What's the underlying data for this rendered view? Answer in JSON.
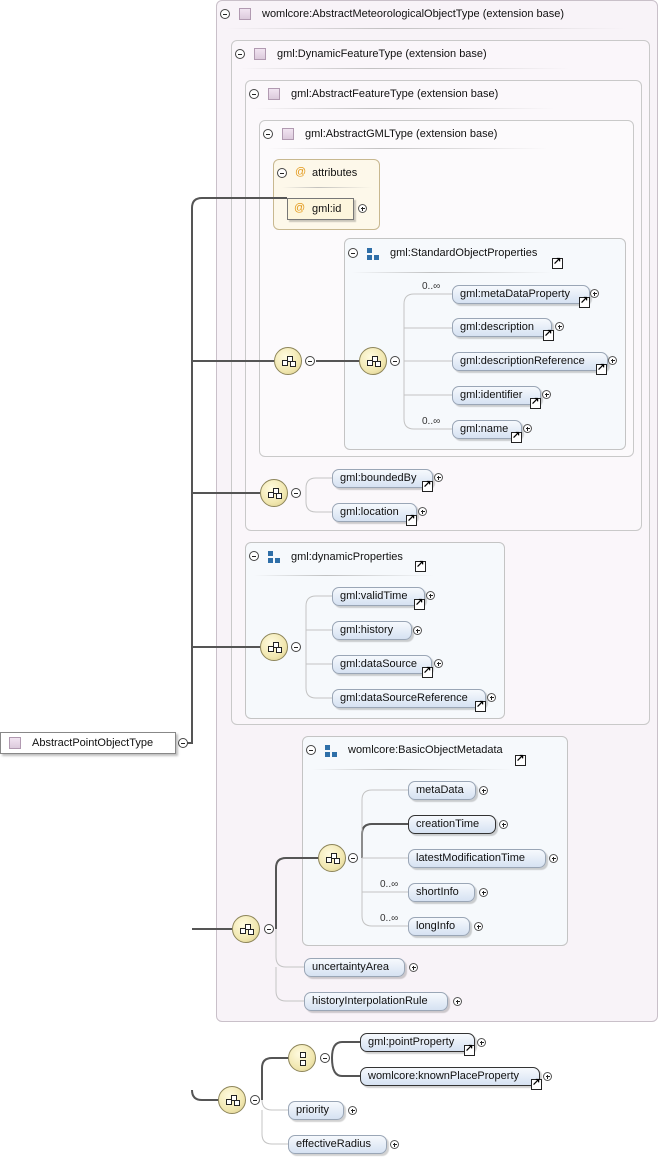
{
  "root": {
    "label": "AbstractPointObjectType"
  },
  "ext": {
    "l1": "womlcore:AbstractMeteorologicalObjectType (extension base)",
    "l2": "gml:DynamicFeatureType (extension base)",
    "l3": "gml:AbstractFeatureType (extension base)",
    "l4": "gml:AbstractGMLType (extension base)"
  },
  "attributes": {
    "header": "attributes",
    "id": "gml:id"
  },
  "groups": {
    "standard": "gml:StandardObjectProperties",
    "dynamic": "gml:dynamicProperties",
    "basic": "womlcore:BasicObjectMetadata"
  },
  "elements": {
    "metaDataProperty": "gml:metaDataProperty",
    "description": "gml:description",
    "descriptionReference": "gml:descriptionReference",
    "identifier": "gml:identifier",
    "name": "gml:name",
    "boundedBy": "gml:boundedBy",
    "location": "gml:location",
    "validTime": "gml:validTime",
    "history": "gml:history",
    "dataSource": "gml:dataSource",
    "dataSourceReference": "gml:dataSourceReference",
    "metaData": "metaData",
    "creationTime": "creationTime",
    "latestModificationTime": "latestModificationTime",
    "shortInfo": "shortInfo",
    "longInfo": "longInfo",
    "uncertaintyArea": "uncertaintyArea",
    "historyInterpolationRule": "historyInterpolationRule",
    "pointProperty": "gml:pointProperty",
    "knownPlaceProperty": "womlcore:knownPlaceProperty",
    "priority": "priority",
    "effectiveRadius": "effectiveRadius"
  },
  "occurrence": {
    "metaDataProperty": "0..∞",
    "name": "0..∞",
    "shortInfo": "0..∞",
    "longInfo": "0..∞"
  },
  "icons": {
    "attribute": "@",
    "complexType": "complex-type-icon",
    "group": "group-icon",
    "sequence": "sequence-compositor-icon",
    "choice": "choice-compositor-icon",
    "link": "reference-link-icon"
  }
}
